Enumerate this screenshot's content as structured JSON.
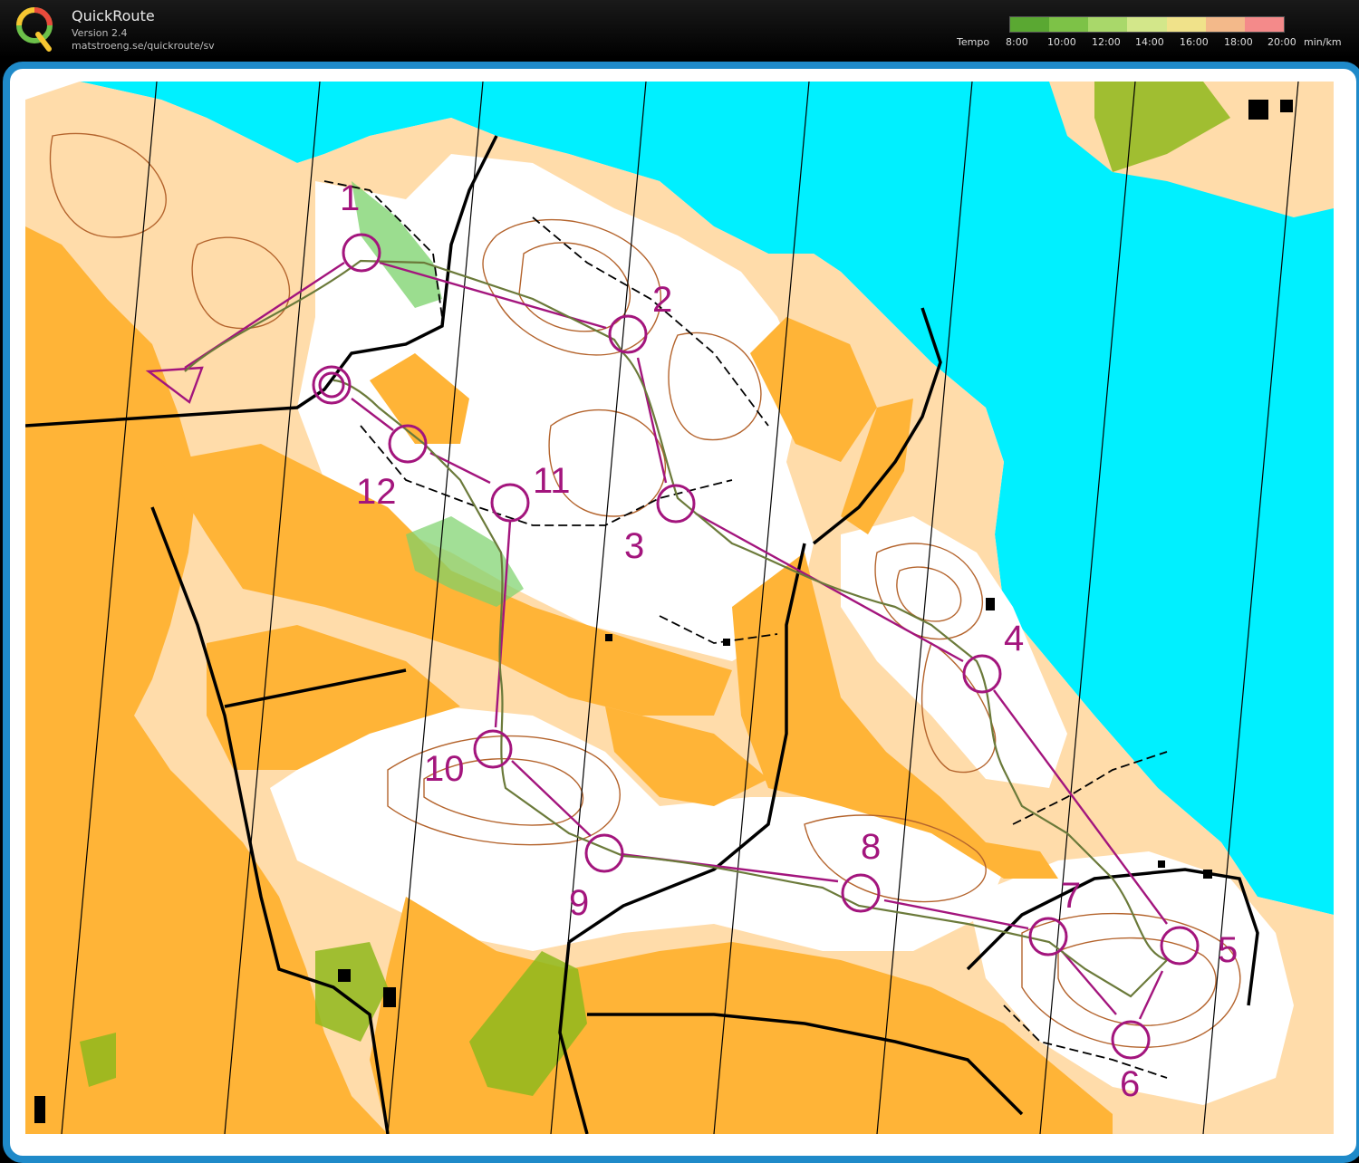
{
  "app": {
    "title": "QuickRoute",
    "version": "Version 2.4",
    "url": "matstroeng.se/quickroute/sv"
  },
  "tempo_legend": {
    "label": "Tempo",
    "ticks": [
      "8:00",
      "10:00",
      "12:00",
      "14:00",
      "16:00",
      "18:00",
      "20:00"
    ],
    "unit": "min/km",
    "colors": [
      "#5aa832",
      "#7dc247",
      "#a9d86a",
      "#d3e78a",
      "#f0e28a",
      "#f3b98a",
      "#f48a8a"
    ]
  },
  "map": {
    "colors": {
      "water": "#00f0ff",
      "open_land": "#ffb437",
      "rough_open": "#ffdcaa",
      "forest": "#ffffff",
      "green": "#7ad26a",
      "course": "#a3157d",
      "contour": "#b4642d",
      "route": "#6b7a3a"
    },
    "controls": [
      {
        "label": "1"
      },
      {
        "label": "2"
      },
      {
        "label": "3"
      },
      {
        "label": "4"
      },
      {
        "label": "5"
      },
      {
        "label": "6"
      },
      {
        "label": "7"
      },
      {
        "label": "8"
      },
      {
        "label": "9"
      },
      {
        "label": "10"
      },
      {
        "label": "11"
      },
      {
        "label": "12"
      }
    ]
  }
}
